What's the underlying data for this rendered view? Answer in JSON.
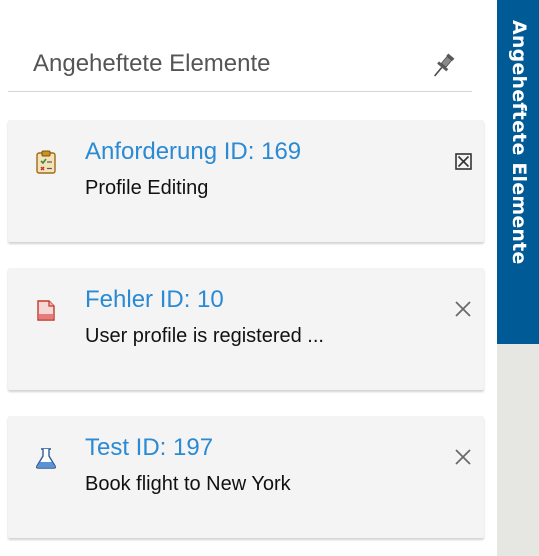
{
  "panel": {
    "title": "Angeheftete Elemente"
  },
  "items": [
    {
      "type": "requirement",
      "icon": "requirement-clipboard-icon",
      "title": "Anforderung ID: 169",
      "subtitle": "Profile Editing",
      "remove_icon": "boxed-close-icon"
    },
    {
      "type": "defect",
      "icon": "defect-document-icon",
      "title": "Fehler ID: 10",
      "subtitle": "User profile is registered ...",
      "remove_icon": "close-icon"
    },
    {
      "type": "test",
      "icon": "test-flask-icon",
      "title": "Test ID: 197",
      "subtitle": "Book flight to New York",
      "remove_icon": "close-icon"
    }
  ],
  "sidebar_tab": {
    "label": "Angeheftete Elemente"
  },
  "colors": {
    "link": "#2a8ad4",
    "tab_background": "#005a96",
    "card_background": "#f4f4f4",
    "sidebar_background": "#e6e6e2"
  }
}
